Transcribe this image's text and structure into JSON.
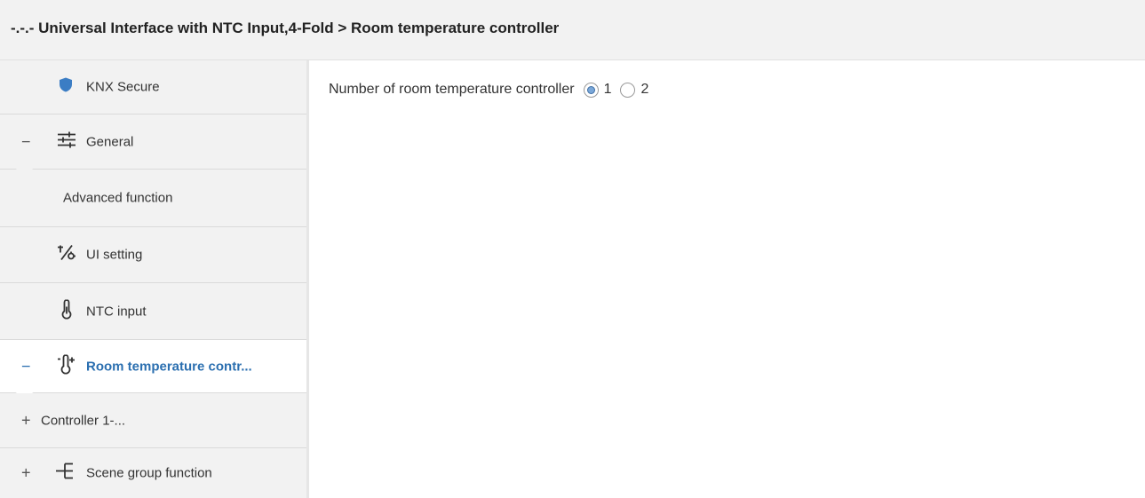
{
  "header": {
    "title": "-.-.- Universal Interface with NTC Input,4-Fold > Room temperature controller"
  },
  "sidebar": {
    "items": [
      {
        "label": "KNX Secure",
        "toggle": "",
        "icon": "shield-icon"
      },
      {
        "label": "General",
        "toggle": "−",
        "icon": "sliders-icon"
      },
      {
        "label": "Advanced function",
        "toggle": "",
        "icon": ""
      },
      {
        "label": "UI setting",
        "toggle": "",
        "icon": "tools-icon"
      },
      {
        "label": "NTC input",
        "toggle": "",
        "icon": "thermometer-icon"
      },
      {
        "label": "Room temperature contr...",
        "toggle": "−",
        "icon": "thermostat-icon"
      },
      {
        "label": "Controller 1-...",
        "toggle": "+",
        "icon": ""
      },
      {
        "label": "Scene group function",
        "toggle": "+",
        "icon": "scene-tree-icon"
      }
    ]
  },
  "main": {
    "param_label": "Number of room temperature controller",
    "options": [
      {
        "label": "1",
        "checked": true
      },
      {
        "label": "2",
        "checked": false
      }
    ]
  },
  "colors": {
    "accent": "#2b6fb0",
    "shield": "#3b7dc4"
  }
}
